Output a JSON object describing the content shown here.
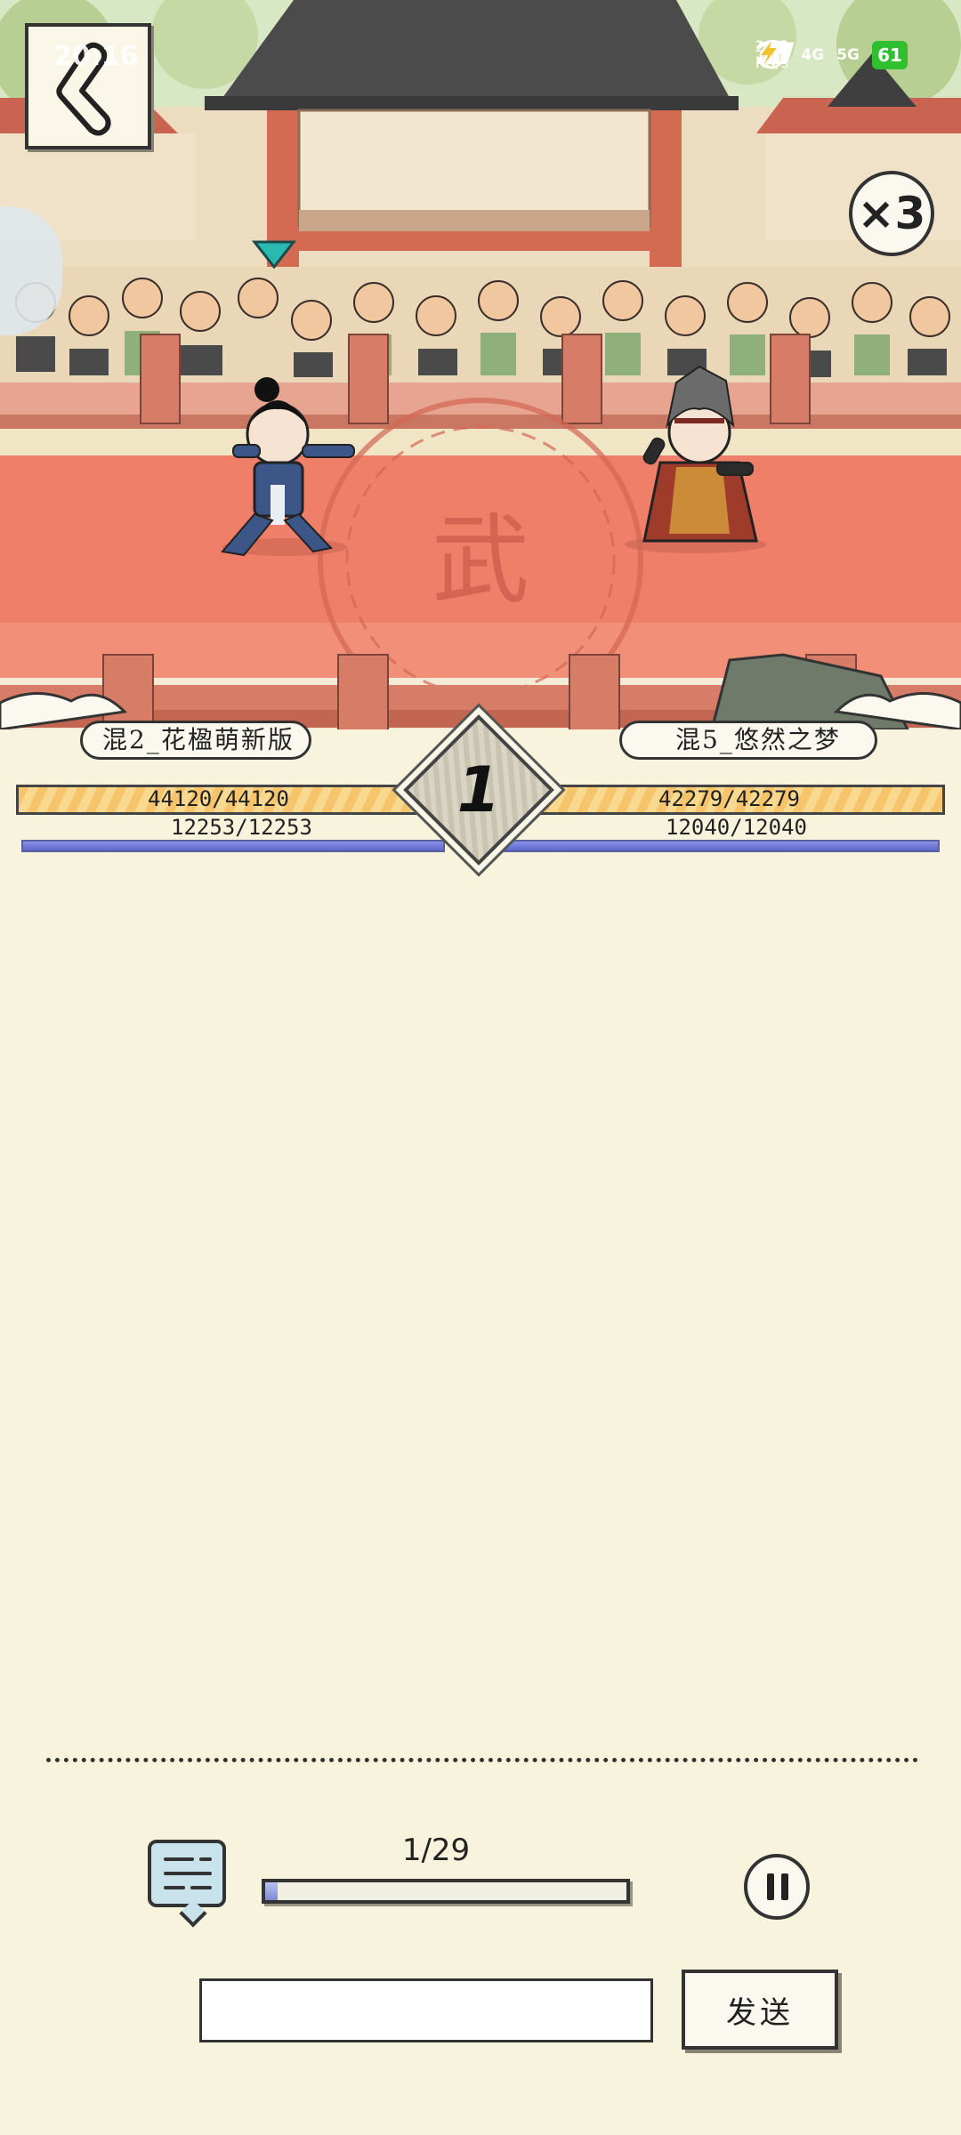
{
  "status_bar": {
    "time": "20:16",
    "speed_value": "29.5",
    "speed_unit": "KB/s",
    "network_1": "4G",
    "network_2": "5G",
    "battery": "61"
  },
  "battle": {
    "speed_multiplier": "×3",
    "round": "1",
    "player_left": {
      "name": "混2_花楹萌新版",
      "hp_text": "44120/44120",
      "mp_text": "12253/12253",
      "hp_fraction": 1.0,
      "mp_fraction": 1.0
    },
    "player_right": {
      "name": "混5_悠然之梦",
      "hp_text": "42279/42279",
      "mp_text": "12040/12040",
      "hp_fraction": 1.0,
      "mp_fraction": 1.0
    },
    "arena_emblem": "武"
  },
  "controls": {
    "progress_text": "1/29",
    "progress_fraction": 0.034,
    "message_placeholder": "",
    "send_label": "发送"
  },
  "colors": {
    "hp": "#f6c46a",
    "mp": "#6b74d6",
    "floor": "#f07f6a",
    "panel": "#f7f3dd",
    "battery": "#2fbf2f"
  }
}
